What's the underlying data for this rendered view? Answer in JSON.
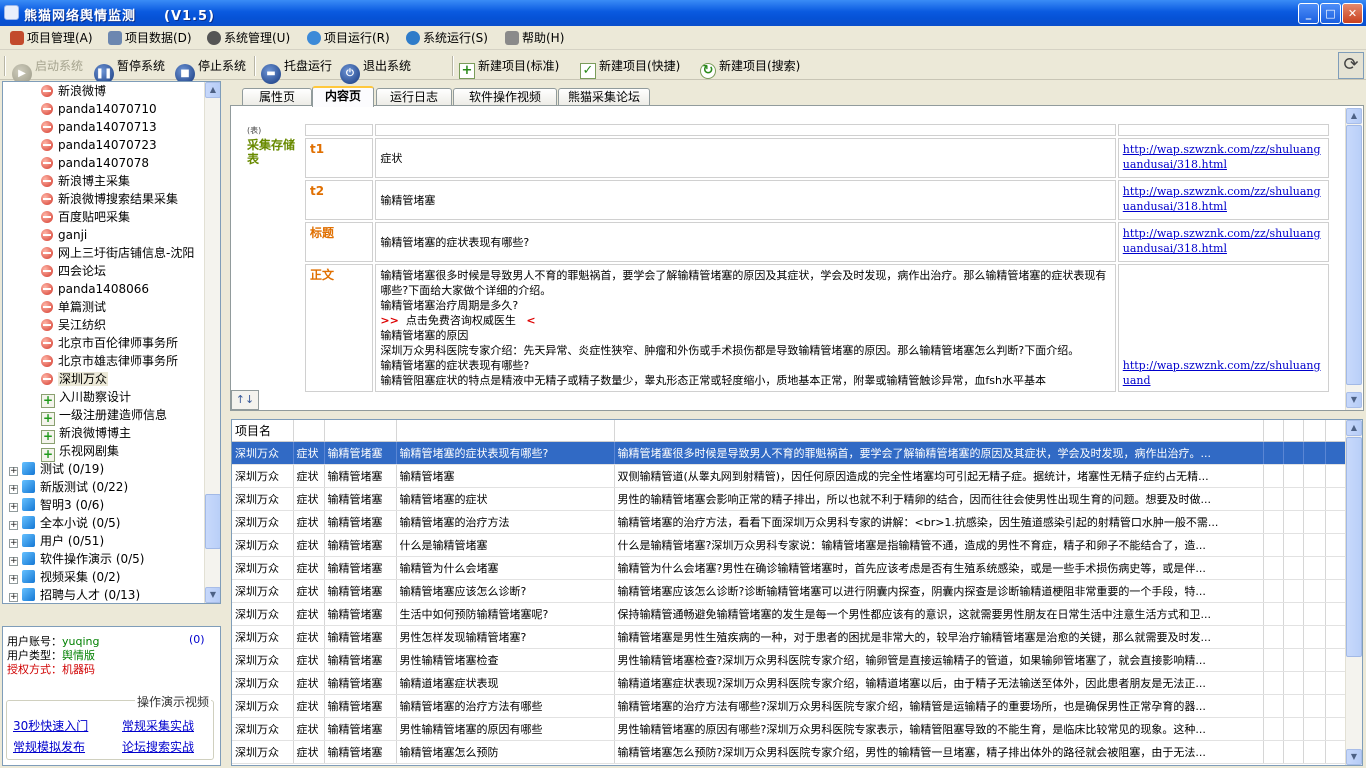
{
  "window": {
    "title": "熊猫网络舆情监测　　(V1.5)",
    "btn_min": "_",
    "btn_max": "□",
    "btn_close": "✕"
  },
  "menu": [
    {
      "label": "项目管理(A)",
      "icon": "project-icon"
    },
    {
      "label": "项目数据(D)",
      "icon": "data-icon"
    },
    {
      "label": "系统管理(U)",
      "icon": "gear-icon"
    },
    {
      "label": "项目运行(R)",
      "icon": "globe-icon"
    },
    {
      "label": "系统运行(S)",
      "icon": "run-icon"
    },
    {
      "label": "帮助(H)",
      "icon": "help-icon"
    }
  ],
  "toolbar": {
    "start": "启动系统",
    "pause": "暂停系统",
    "stop": "停止系统",
    "tray": "托盘运行",
    "exit": "退出系统",
    "new_std": "新建项目(标准)",
    "new_quick": "新建项目(快捷)",
    "new_search": "新建项目(搜索)"
  },
  "tree": {
    "items": [
      {
        "label": "新浪微博",
        "type": "red"
      },
      {
        "label": "panda14070710",
        "type": "red"
      },
      {
        "label": "panda14070713",
        "type": "red"
      },
      {
        "label": "panda14070723",
        "type": "red"
      },
      {
        "label": "panda1407078",
        "type": "red"
      },
      {
        "label": "新浪博主采集",
        "type": "red"
      },
      {
        "label": "新浪微博搜索结果采集",
        "type": "red"
      },
      {
        "label": "百度贴吧采集",
        "type": "red"
      },
      {
        "label": "ganji",
        "type": "red"
      },
      {
        "label": "网上三圩街店铺信息-沈阳",
        "type": "red"
      },
      {
        "label": "四会论坛",
        "type": "red"
      },
      {
        "label": "panda1408066",
        "type": "red"
      },
      {
        "label": "单篇测试",
        "type": "red"
      },
      {
        "label": "吴江纺织",
        "type": "red"
      },
      {
        "label": "北京市百伦律师事务所",
        "type": "red"
      },
      {
        "label": "北京市雄志律师事务所",
        "type": "red"
      },
      {
        "label": "深圳万众",
        "type": "red",
        "selected": true
      },
      {
        "label": "入川勘察设计",
        "type": "green"
      },
      {
        "label": "一级注册建造师信息",
        "type": "green"
      },
      {
        "label": "新浪微博博主",
        "type": "green"
      },
      {
        "label": "乐视网剧集",
        "type": "green"
      }
    ],
    "folders": [
      {
        "label": "测试 (0/19)"
      },
      {
        "label": "新版测试 (0/22)"
      },
      {
        "label": "智明3 (0/6)"
      },
      {
        "label": "全本小说 (0/5)"
      },
      {
        "label": "用户 (0/51)"
      },
      {
        "label": "软件操作演示 (0/5)"
      },
      {
        "label": "视频采集 (0/2)"
      },
      {
        "label": "招聘与人才 (0/13)"
      }
    ]
  },
  "info": {
    "account_label": "用户账号：",
    "account": "yuqing",
    "count": "(0)",
    "type_label": "用户类型：",
    "type": "舆情版",
    "auth_label": "授权方式：",
    "auth": "机器码"
  },
  "demo": {
    "legend": "操作演示视频",
    "links": [
      "30秒快速入门",
      "常规采集实战",
      "常规模拟发布",
      "论坛搜索实战"
    ]
  },
  "tabs": [
    "属性页",
    "内容页",
    "运行日志",
    "软件操作视频",
    "熊猫采集论坛"
  ],
  "content": {
    "side_small": "(表)",
    "side_label": "采集存储表",
    "rows": [
      {
        "key": "t1",
        "value": "症状",
        "url": "http://wap.szwznk.com/zz/shuluanguandusai/318.html"
      },
      {
        "key": "t2",
        "value": "输精管堵塞",
        "url": "http://wap.szwznk.com/zz/shuluanguandusai/318.html"
      },
      {
        "key": "标题",
        "value": "输精管堵塞的症状表现有哪些?",
        "url": "http://wap.szwznk.com/zz/shuluanguandusai/318.html"
      },
      {
        "key": "正文",
        "url": "http://wap.szwznk.com/zz/shuluanguand",
        "lines": [
          "输精管堵塞很多时候是导致男人不育的罪魁祸首，要学会了解输精管堵塞的原因及其症状，学会及时发现，病作出治疗。那么输精管堵塞的症状表现有哪些?下面给大家做个详细的介绍。",
          "输精管堵塞治疗周期是多久?",
          "点击免费咨询权威医生",
          "输精管堵塞的原因",
          "深圳万众男科医院专家介绍：先天异常、炎症性狭窄、肿瘤和外伤或手术损伤都是导致输精管堵塞的原因。那么输精管堵塞怎么判断?下面介绍。",
          "输精管堵塞的症状表现有哪些?",
          "输精管阻塞症状的特点是精液中无精子或精子数量少，睾丸形态正常或轻度缩小，质地基本正常，附睾或输精管触诊异常，血fsh水平基本"
        ]
      }
    ]
  },
  "grid": {
    "header": "项目名",
    "rows": [
      [
        "深圳万众",
        "症状",
        "输精管堵塞",
        "输精管堵塞的症状表现有哪些?",
        "输精管堵塞很多时候是导致男人不育的罪魁祸首，要学会了解输精管堵塞的原因及其症状，学会及时发现，病作出治疗。..."
      ],
      [
        "深圳万众",
        "症状",
        "输精管堵塞",
        "输精管堵塞",
        "双侧输精管道(从睾丸网到射精管)，因任何原因造成的完全性堵塞均可引起无精子症。据统计，堵塞性无精子症约占无精..."
      ],
      [
        "深圳万众",
        "症状",
        "输精管堵塞",
        "输精管堵塞的症状",
        "男性的输精管堵塞会影响正常的精子排出，所以也就不利于精卵的结合，因而往往会使男性出现生育的问题。想要及时做..."
      ],
      [
        "深圳万众",
        "症状",
        "输精管堵塞",
        "输精管堵塞的治疗方法",
        "输精管堵塞的治疗方法，看看下面深圳万众男科专家的讲解：<br>1.抗感染，因生殖道感染引起的射精管口水肿一般不需..."
      ],
      [
        "深圳万众",
        "症状",
        "输精管堵塞",
        "什么是输精管堵塞",
        "什么是输精管堵塞?深圳万众男科专家说：输精管堵塞是指输精管不通，造成的男性不育症，精子和卵子不能结合了，造..."
      ],
      [
        "深圳万众",
        "症状",
        "输精管堵塞",
        "输精管为什么会堵塞",
        "输精管为什么会堵塞?男性在确诊输精管堵塞时，首先应该考虑是否有生殖系统感染，或是一些手术损伤病史等，或是伴..."
      ],
      [
        "深圳万众",
        "症状",
        "输精管堵塞",
        "输精管堵塞应该怎么诊断?",
        "输精管堵塞应该怎么诊断?诊断输精管堵塞可以进行阴囊内探查，阴囊内探查是诊断输精道梗阻非常重要的一个手段，特..."
      ],
      [
        "深圳万众",
        "症状",
        "输精管堵塞",
        "生活中如何预防输精管堵塞呢?",
        "保持输精管通畅避免输精管堵塞的发生是每一个男性都应该有的意识，这就需要男性朋友在日常生活中注意生活方式和卫..."
      ],
      [
        "深圳万众",
        "症状",
        "输精管堵塞",
        "男性怎样发现输精管堵塞?",
        "输精管堵塞是男性生殖疾病的一种，对于患者的困扰是非常大的，较早治疗输精管堵塞是治愈的关键，那么就需要及时发..."
      ],
      [
        "深圳万众",
        "症状",
        "输精管堵塞",
        "男性输精管堵塞检查",
        "男性输精管堵塞检查?深圳万众男科医院专家介绍，输卵管是直接运输精子的管道，如果输卵管堵塞了，就会直接影响精..."
      ],
      [
        "深圳万众",
        "症状",
        "输精管堵塞",
        "输精道堵塞症状表现",
        "输精道堵塞症状表现?深圳万众男科医院专家介绍，输精道堵塞以后，由于精子无法输送至体外，因此患者朋友是无法正..."
      ],
      [
        "深圳万众",
        "症状",
        "输精管堵塞",
        "输精管堵塞的治疗方法有哪些",
        "输精管堵塞的治疗方法有哪些?深圳万众男科医院专家介绍，输精管是运输精子的重要场所，也是确保男性正常孕育的器..."
      ],
      [
        "深圳万众",
        "症状",
        "输精管堵塞",
        "男性输精管堵塞的原因有哪些",
        "男性输精管堵塞的原因有哪些?深圳万众男科医院专家表示，输精管阻塞导致的不能生育，是临床比较常见的现象。这种..."
      ],
      [
        "深圳万众",
        "症状",
        "输精管堵塞",
        "输精管堵塞怎么预防",
        "输精管堵塞怎么预防?深圳万众男科医院专家介绍，男性的输精管一旦堵塞，精子排出体外的路径就会被阻塞，由于无法..."
      ]
    ]
  }
}
